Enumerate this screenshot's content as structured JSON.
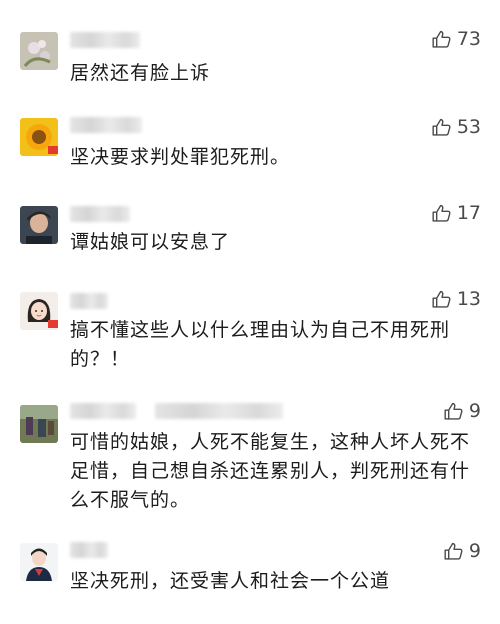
{
  "comments": [
    {
      "likes": "73",
      "text": "居然还有脸上诉"
    },
    {
      "likes": "53",
      "text": "坚决要求判处罪犯死刑。"
    },
    {
      "likes": "17",
      "text": "谭姑娘可以安息了"
    },
    {
      "likes": "13",
      "text": "搞不懂这些人以什么理由认为自己不用死刑的？！"
    },
    {
      "likes": "9",
      "text": "可惜的姑娘，人死不能复生，这种人坏人死不足惜，自己想自杀还连累别人，判死刑还有什么不服气的。"
    },
    {
      "likes": "9",
      "text": "坚决死刑，还受害人和社会一个公道"
    }
  ],
  "icons": {
    "like": "thumbs-up-icon"
  },
  "colors": {
    "text": "#1c1c1c",
    "likes": "#4a4a4a",
    "background": "#ffffff"
  }
}
